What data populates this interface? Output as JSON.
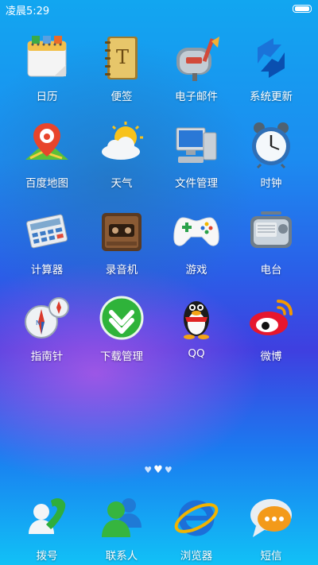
{
  "status": {
    "time": "凌晨5:29"
  },
  "apps": [
    {
      "label": "日历",
      "icon": "calendar-icon"
    },
    {
      "label": "便签",
      "icon": "notepad-icon"
    },
    {
      "label": "电子邮件",
      "icon": "mailbox-icon"
    },
    {
      "label": "系统更新",
      "icon": "update-arrows-icon"
    },
    {
      "label": "百度地图",
      "icon": "map-pin-icon"
    },
    {
      "label": "天气",
      "icon": "weather-sun-cloud-icon"
    },
    {
      "label": "文件管理",
      "icon": "computer-icon"
    },
    {
      "label": "时钟",
      "icon": "alarm-clock-icon"
    },
    {
      "label": "计算器",
      "icon": "calculator-icon"
    },
    {
      "label": "录音机",
      "icon": "tape-recorder-icon"
    },
    {
      "label": "游戏",
      "icon": "gamepad-icon"
    },
    {
      "label": "电台",
      "icon": "radio-icon"
    },
    {
      "label": "指南针",
      "icon": "compass-icon"
    },
    {
      "label": "下载管理",
      "icon": "download-arrow-icon"
    },
    {
      "label": "QQ",
      "icon": "penguin-icon"
    },
    {
      "label": "微博",
      "icon": "weibo-eye-icon"
    }
  ],
  "pager": {
    "count": 3,
    "active_index": 1
  },
  "dock": [
    {
      "label": "拨号",
      "icon": "phone-icon"
    },
    {
      "label": "联系人",
      "icon": "contacts-icon"
    },
    {
      "label": "浏览器",
      "icon": "ie-browser-icon"
    },
    {
      "label": "短信",
      "icon": "message-bubble-icon"
    }
  ]
}
